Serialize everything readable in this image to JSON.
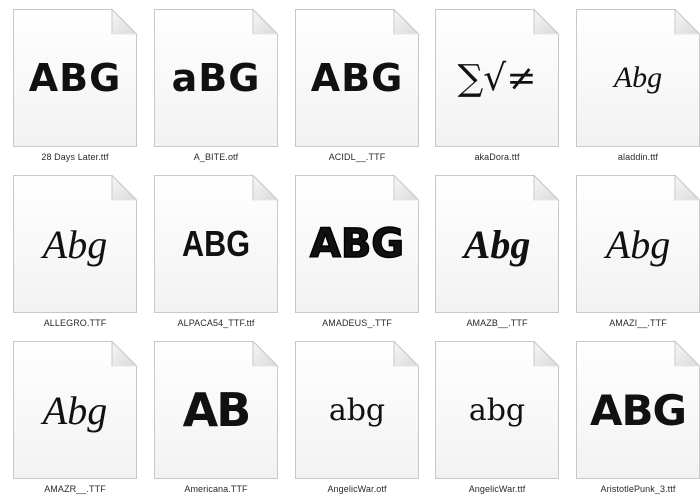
{
  "files": [
    {
      "name": "28 Days Later.ttf",
      "preview": "ABG",
      "style": "grunge"
    },
    {
      "name": "A_BITE.otf",
      "preview": "aBG",
      "style": "grunge"
    },
    {
      "name": "ACIDL__.TTF",
      "preview": "ABG",
      "style": "grunge"
    },
    {
      "name": "akaDora.ttf",
      "preview": "∑√≠",
      "style": "math"
    },
    {
      "name": "aladdin.ttf",
      "preview": "Abg",
      "style": "small-script"
    },
    {
      "name": "ALLEGRO.TTF",
      "preview": "Abg",
      "style": "script"
    },
    {
      "name": "ALPACA54_TTF.ttf",
      "preview": "ABG",
      "style": "condensed"
    },
    {
      "name": "AMADEUS_.TTF",
      "preview": "ABG",
      "style": "outline"
    },
    {
      "name": "AMAZB__.TTF",
      "preview": "Abg",
      "style": "bold-italic"
    },
    {
      "name": "AMAZI__.TTF",
      "preview": "Abg",
      "style": "script"
    },
    {
      "name": "AMAZR__.TTF",
      "preview": "Abg",
      "style": "script"
    },
    {
      "name": "Americana.TTF",
      "preview": "AB",
      "style": "flag"
    },
    {
      "name": "AngelicWar.otf",
      "preview": "abg",
      "style": "angel"
    },
    {
      "name": "AngelicWar.ttf",
      "preview": "abg",
      "style": "angel"
    },
    {
      "name": "AristotlePunk_3.ttf",
      "preview": "ABG",
      "style": "punk"
    }
  ]
}
